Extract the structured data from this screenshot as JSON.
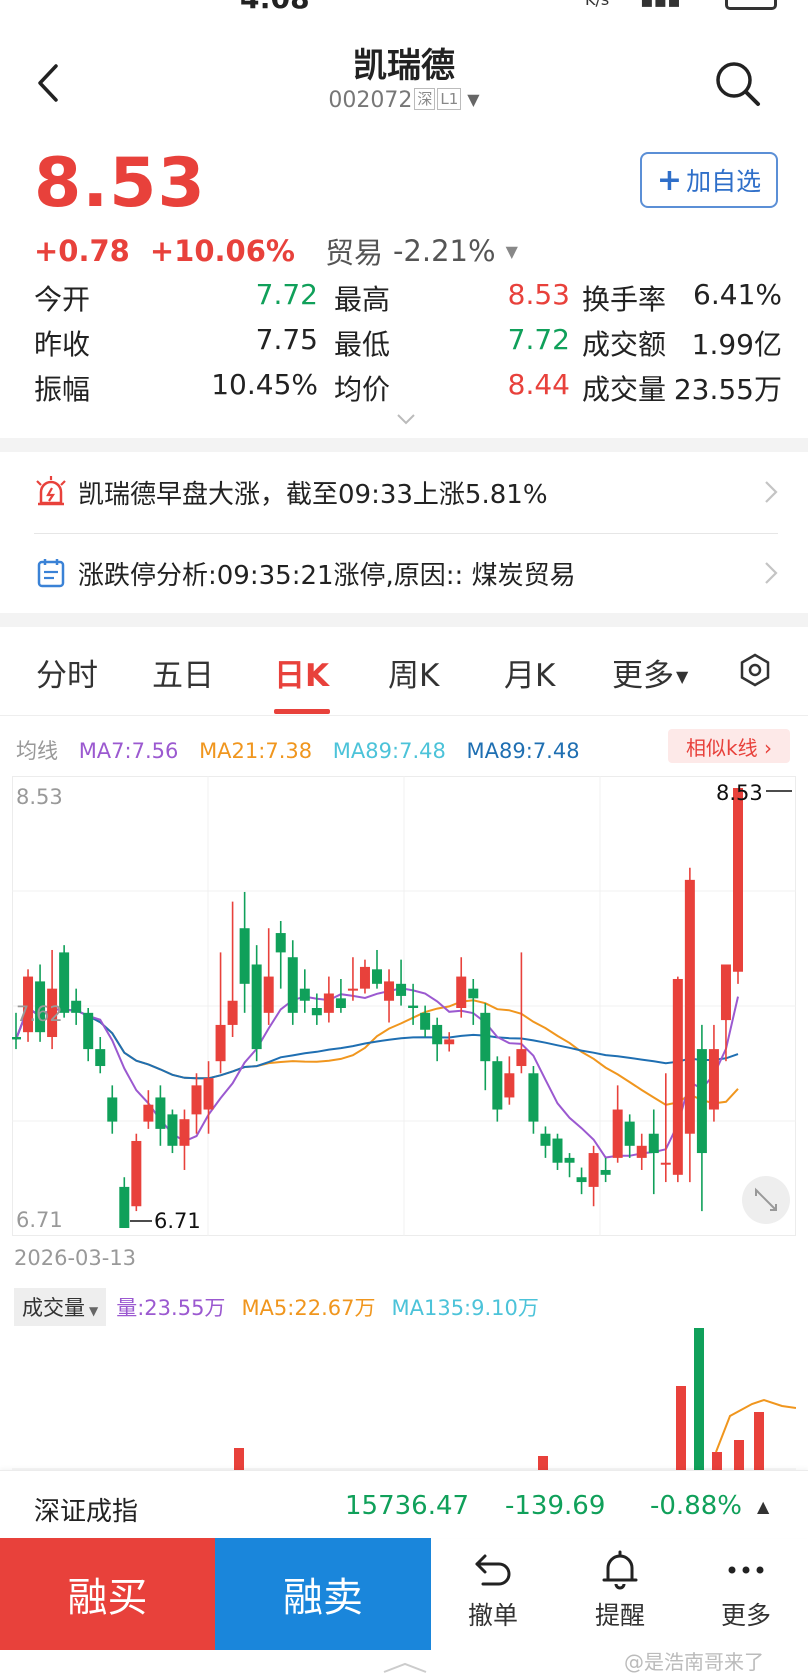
{
  "status_bar": {
    "time": "4:08",
    "net_unit": "K/s"
  },
  "header": {
    "title": "凯瑞德",
    "code": "002072",
    "market_tag": "深",
    "level_tag": "L1"
  },
  "quote": {
    "price": "8.53",
    "change": "+0.78",
    "change_pct": "+10.06%",
    "sector_name": "贸易",
    "sector_pct": "-2.21%",
    "add_watchlist_label": "加自选"
  },
  "stats": [
    [
      {
        "label": "今开",
        "value": "7.72",
        "color": "green"
      },
      {
        "label": "最高",
        "value": "8.53",
        "color": "red"
      },
      {
        "label": "换手率",
        "value": "6.41%",
        "color": "neutral"
      }
    ],
    [
      {
        "label": "昨收",
        "value": "7.75",
        "color": "neutral"
      },
      {
        "label": "最低",
        "value": "7.72",
        "color": "green"
      },
      {
        "label": "成交额",
        "value": "1.99亿",
        "color": "neutral"
      }
    ],
    [
      {
        "label": "振幅",
        "value": "10.45%",
        "color": "neutral"
      },
      {
        "label": "均价",
        "value": "8.44",
        "color": "red"
      },
      {
        "label": "成交量",
        "value": "23.55万",
        "color": "neutral"
      }
    ]
  ],
  "news": [
    {
      "icon": "alarm-icon",
      "text": "凯瑞德早盘大涨，截至09:33上涨5.81%"
    },
    {
      "icon": "calendar-icon",
      "text": "涨跌停分析:09:35:21涨停,原因::  煤炭贸易"
    }
  ],
  "tabs": [
    "分时",
    "五日",
    "日K",
    "周K",
    "月K",
    "更多"
  ],
  "active_tab": "日K",
  "ma_legend": {
    "title": "均线",
    "ma7": "MA7:7.56",
    "ma21": "MA21:7.38",
    "ma89a": "MA89:7.48",
    "ma89b": "MA89:7.48",
    "similar_label": "相似k线 ›"
  },
  "colors": {
    "up": "#e8413b",
    "down": "#10a05a",
    "ma7": "#9b59d0",
    "ma21": "#f0961e",
    "ma89a": "#4cc3d9",
    "ma89b": "#1f6fb2"
  },
  "chart_data": {
    "type": "candlestick",
    "y_labels": [
      "8.53",
      "7.62",
      "6.71"
    ],
    "ylim": [
      6.71,
      8.53
    ],
    "high_marker": "8.53",
    "low_marker": "6.71",
    "date_start": "2026-03-13",
    "candles": [
      [
        7.5,
        7.49,
        7.6,
        7.45
      ],
      [
        7.52,
        7.75,
        7.78,
        7.48
      ],
      [
        7.73,
        7.52,
        7.8,
        7.48
      ],
      [
        7.5,
        7.7,
        7.86,
        7.45
      ],
      [
        7.85,
        7.6,
        7.88,
        7.58
      ],
      [
        7.65,
        7.6,
        7.7,
        7.55
      ],
      [
        7.6,
        7.45,
        7.62,
        7.4
      ],
      [
        7.45,
        7.38,
        7.5,
        7.35
      ],
      [
        7.25,
        7.15,
        7.3,
        7.1
      ],
      [
        6.88,
        6.71,
        6.92,
        6.71
      ],
      [
        6.8,
        7.07,
        7.1,
        6.78
      ],
      [
        7.15,
        7.22,
        7.28,
        7.12
      ],
      [
        7.25,
        7.12,
        7.3,
        7.05
      ],
      [
        7.18,
        7.05,
        7.2,
        7.02
      ],
      [
        7.05,
        7.16,
        7.2,
        6.95
      ],
      [
        7.18,
        7.3,
        7.35,
        7.1
      ],
      [
        7.2,
        7.33,
        7.4,
        7.1
      ],
      [
        7.4,
        7.55,
        7.85,
        7.35
      ],
      [
        7.55,
        7.65,
        8.06,
        7.5
      ],
      [
        7.95,
        7.72,
        8.1,
        7.6
      ],
      [
        7.8,
        7.45,
        7.88,
        7.4
      ],
      [
        7.6,
        7.75,
        7.95,
        7.55
      ],
      [
        7.93,
        7.85,
        7.98,
        7.7
      ],
      [
        7.83,
        7.6,
        7.9,
        7.55
      ],
      [
        7.7,
        7.65,
        7.78,
        7.6
      ],
      [
        7.62,
        7.59,
        7.68,
        7.55
      ],
      [
        7.6,
        7.68,
        7.75,
        7.56
      ],
      [
        7.66,
        7.62,
        7.74,
        7.6
      ],
      [
        7.7,
        7.7,
        7.83,
        7.65
      ],
      [
        7.7,
        7.79,
        7.82,
        7.68
      ],
      [
        7.78,
        7.72,
        7.86,
        7.7
      ],
      [
        7.65,
        7.73,
        7.78,
        7.56
      ],
      [
        7.72,
        7.67,
        7.82,
        7.63
      ],
      [
        7.63,
        7.62,
        7.72,
        7.55
      ],
      [
        7.6,
        7.53,
        7.63,
        7.5
      ],
      [
        7.55,
        7.47,
        7.58,
        7.4
      ],
      [
        7.47,
        7.49,
        7.52,
        7.44
      ],
      [
        7.62,
        7.75,
        7.83,
        7.58
      ],
      [
        7.7,
        7.66,
        7.74,
        7.55
      ],
      [
        7.6,
        7.4,
        7.64,
        7.28
      ],
      [
        7.4,
        7.2,
        7.42,
        7.15
      ],
      [
        7.25,
        7.35,
        7.42,
        7.22
      ],
      [
        7.38,
        7.45,
        7.85,
        7.35
      ],
      [
        7.35,
        7.15,
        7.38,
        7.1
      ],
      [
        7.1,
        7.05,
        7.13,
        7.0
      ],
      [
        7.08,
        6.98,
        7.1,
        6.95
      ],
      [
        7.0,
        6.98,
        7.02,
        6.92
      ],
      [
        6.92,
        6.9,
        6.96,
        6.85
      ],
      [
        6.88,
        7.02,
        7.05,
        6.8
      ],
      [
        6.95,
        6.93,
        7.0,
        6.9
      ],
      [
        7.0,
        7.2,
        7.3,
        6.98
      ],
      [
        7.15,
        7.05,
        7.18,
        7.0
      ],
      [
        7.0,
        7.05,
        7.1,
        6.95
      ],
      [
        7.1,
        7.02,
        7.2,
        6.85
      ],
      [
        6.98,
        6.98,
        7.35,
        6.9
      ],
      [
        6.93,
        7.74,
        7.75,
        6.9
      ],
      [
        7.1,
        8.15,
        8.2,
        6.9
      ],
      [
        7.45,
        7.02,
        7.55,
        6.78
      ],
      [
        7.2,
        7.45,
        7.55,
        7.15
      ],
      [
        7.57,
        7.8,
        7.78,
        7.4
      ],
      [
        7.77,
        8.53,
        8.53,
        7.72
      ]
    ],
    "volume_label": "成交量",
    "volume": "量:23.55万",
    "vol_ma5": "MA5:22.67万",
    "vol_ma135": "MA135:9.10万"
  },
  "index": {
    "name": "深证成指",
    "value": "15736.47",
    "change": "-139.69",
    "pct": "-0.88%"
  },
  "bottom": {
    "buy": "融买",
    "sell": "融卖",
    "cancel": "撤单",
    "remind": "提醒",
    "more": "更多"
  },
  "watermark": "@是浩南哥来了"
}
